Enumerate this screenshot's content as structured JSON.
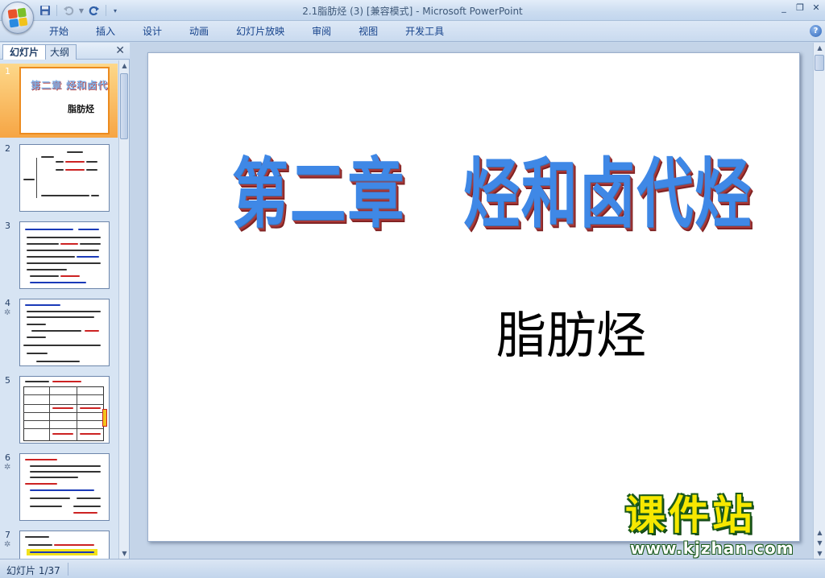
{
  "window": {
    "title": "2.1脂肪烃 (3) [兼容模式] - Microsoft PowerPoint",
    "controls": [
      "_",
      "❐",
      "✕"
    ]
  },
  "quick_access": {
    "save_icon": "save-icon",
    "undo_icon": "undo-icon",
    "redo_icon": "redo-icon",
    "customize_icon": "customize-icon"
  },
  "ribbon": {
    "tabs": [
      "开始",
      "插入",
      "设计",
      "动画",
      "幻灯片放映",
      "审阅",
      "视图",
      "开发工具"
    ],
    "help": "?"
  },
  "slide_panel": {
    "tabs": [
      "幻灯片",
      "大纲"
    ],
    "close": "✕",
    "thumbnails": [
      {
        "number": "1",
        "selected": true,
        "title": "第二章 烃和卤代烃",
        "subtitle": "脂肪烃"
      },
      {
        "number": "2",
        "selected": false
      },
      {
        "number": "3",
        "selected": false
      },
      {
        "number": "4",
        "selected": false,
        "animated": true
      },
      {
        "number": "5",
        "selected": false
      },
      {
        "number": "6",
        "selected": false,
        "animated": true
      },
      {
        "number": "7",
        "selected": false,
        "animated": true
      }
    ]
  },
  "slide": {
    "title": "第二章　烃和卤代烃",
    "subtitle": "脂肪烃"
  },
  "watermark": {
    "main": "课件站",
    "url": "www.kjzhan.com"
  },
  "status_bar": {
    "slide_indicator": "幻灯片 1/37"
  },
  "colors": {
    "accent": "#15428b",
    "title_fill": "#3f88e6",
    "title_shadow": "#a83a3a",
    "selected_thumb": "#f6a544",
    "watermark_fill": "#f6e800"
  }
}
